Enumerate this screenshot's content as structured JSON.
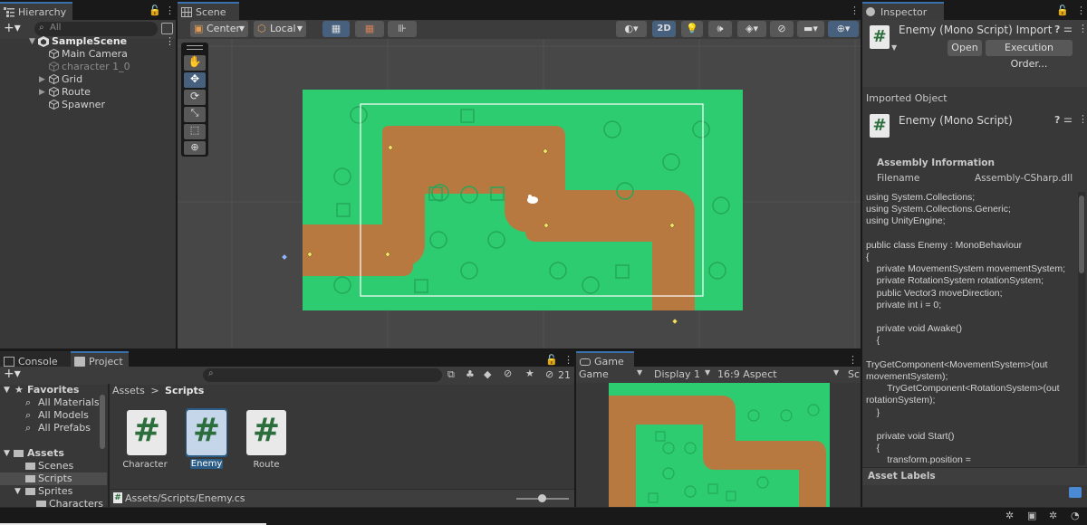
{
  "hierarchy": {
    "tab_label": "Hierarchy",
    "search_placeholder": "All",
    "scene_name": "SampleScene",
    "items": [
      "Main Camera",
      "character 1_0",
      "Grid",
      "Route",
      "Spawner"
    ]
  },
  "scene": {
    "tab_label": "Scene",
    "pivot_label": "Center",
    "space_label": "Local",
    "mode_2d_label": "2D"
  },
  "inspector": {
    "tab_label": "Inspector",
    "title": "Enemy (Mono Script) Import S",
    "open_button": "Open",
    "exec_order_button": "Execution Order...",
    "imported_object_label": "Imported Object",
    "object_name": "Enemy (Mono Script)",
    "assembly_info_label": "Assembly Information",
    "filename_label": "Filename",
    "filename_value": "Assembly-CSharp.dll",
    "code_lines": [
      "using System.Collections;",
      "using System.Collections.Generic;",
      "using UnityEngine;",
      "",
      "public class Enemy : MonoBehaviour",
      "{",
      "    private MovementSystem movementSystem;",
      "    private RotationSystem rotationSystem;",
      "    public Vector3 moveDirection;",
      "    private int i = 0;",
      "",
      "    private void Awake()",
      "    {",
      "",
      "TryGetComponent<MovementSystem>(out",
      "movementSystem);",
      "        TryGetComponent<RotationSystem>(out",
      "rotationSystem);",
      "    }",
      "",
      "    private void Start()",
      "    {",
      "        transform.position ="
    ],
    "asset_labels": "Asset Labels"
  },
  "console": {
    "tab_label": "Console"
  },
  "project": {
    "tab_label": "Project",
    "hidden_count": "21",
    "favorites": "Favorites",
    "fav_items": [
      "All Materials",
      "All Models",
      "All Prefabs"
    ],
    "assets": "Assets",
    "asset_items": [
      "Scenes",
      "Scripts",
      "Sprites"
    ],
    "sprites_child": "Characters",
    "breadcrumb_root": "Assets",
    "breadcrumb_sep": ">",
    "breadcrumb_current": "Scripts",
    "files": [
      "Character",
      "Enemy",
      "Route"
    ],
    "selected_path": "Assets/Scripts/Enemy.cs"
  },
  "game": {
    "tab_label": "Game",
    "view_label": "Game",
    "display_label": "Display 1",
    "aspect_label": "16:9 Aspect",
    "overflow_label": "Sc"
  },
  "colors": {
    "grass": "#2ecc71",
    "path": "#b87941",
    "accent": "#3a72b0",
    "selection": "#2c5d87"
  }
}
